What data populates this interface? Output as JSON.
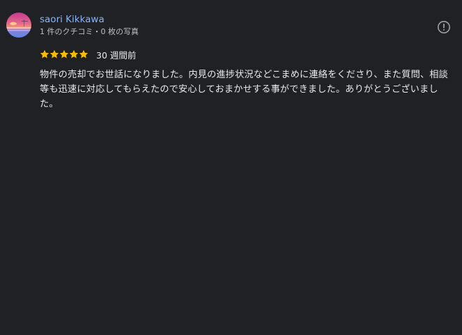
{
  "reviewer": {
    "name": "saori Kikkawa",
    "meta": "1 件のクチコミ・0 枚の写真"
  },
  "review": {
    "rating": 5,
    "rating_max": 5,
    "date": "30 週間前",
    "text": "物件の売却でお世話になりました。内見の進捗状況などこまめに連絡をくださり、また質問、相談等も迅速に対応してもらえたので安心しておまかせする事ができました。ありがとうございました。"
  },
  "icons": {
    "avatar": "profile-photo",
    "report": "report-icon",
    "star": "star-icon"
  },
  "colors": {
    "background": "#202124",
    "name_link": "#8ab4f8",
    "star": "#fbbc04",
    "text": "#e8eaed",
    "meta": "#bdc1c6"
  }
}
